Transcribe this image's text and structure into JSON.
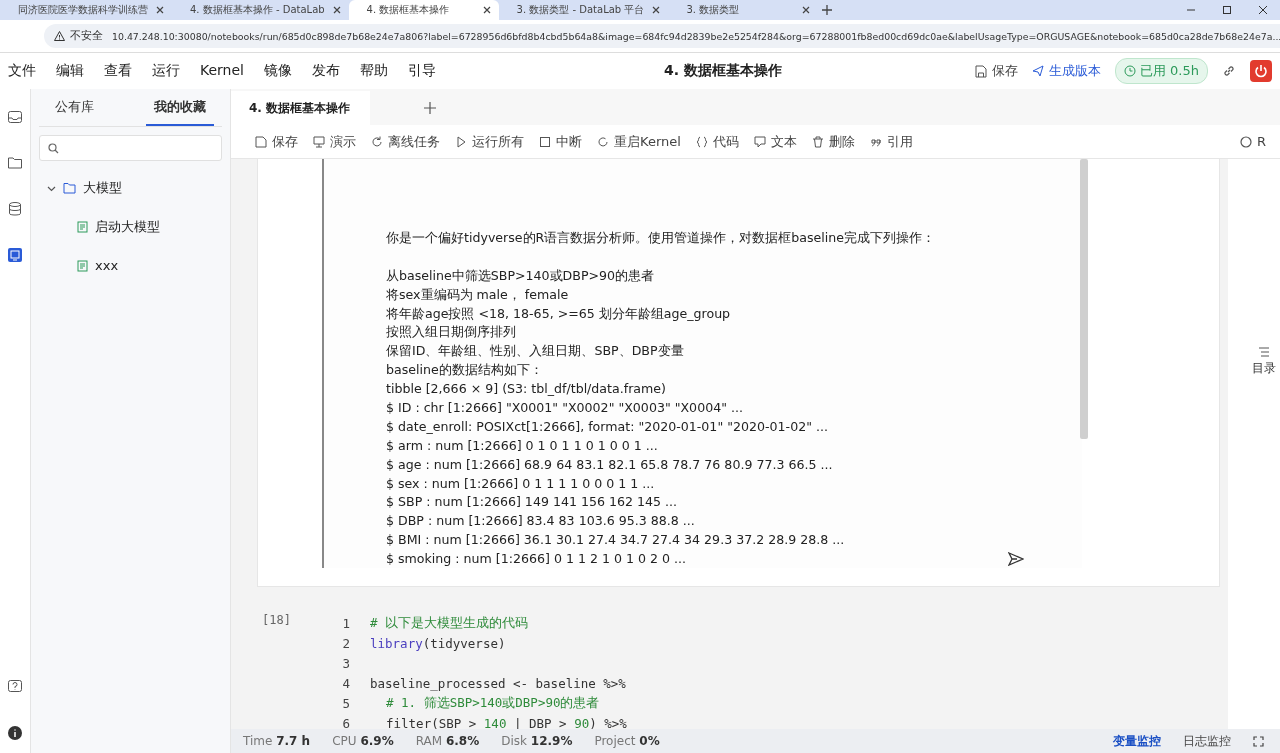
{
  "browser": {
    "tabs": [
      {
        "label": "同济医院医学数据科学训练营",
        "selected": false
      },
      {
        "label": "4. 数据框基本操作 - DataLab",
        "selected": false
      },
      {
        "label": "4. 数据框基本操作",
        "selected": true
      },
      {
        "label": "3. 数据类型 - DataLab 平台",
        "selected": false
      },
      {
        "label": "3. 数据类型",
        "selected": false
      }
    ],
    "security_label": "不安全",
    "url": "10.47.248.10:30080/notebooks/run/685d0c898de7b68e24e7a806?label=6728956d6bfd8b4cbd5b64a8&image=684fc94d2839be2e5254f284&org=67288001fb8ed00cd69dc0ae&labelUsageType=ORGUSAGE&notebook=685d0ca28de7b68e24e7a..."
  },
  "menu": {
    "items": [
      "文件",
      "编辑",
      "查看",
      "运行",
      "Kernel",
      "镜像",
      "发布",
      "帮助",
      "引导"
    ],
    "title": "4. 数据框基本操作",
    "save": "保存",
    "publish": "生成版本",
    "usage": "已用 0.5h"
  },
  "sidebar": {
    "tabs": [
      {
        "label": "公有库",
        "selected": false
      },
      {
        "label": "我的收藏",
        "selected": true
      }
    ],
    "tree": [
      {
        "label": "大模型",
        "expanded": true,
        "children": [
          {
            "label": "启动大模型"
          },
          {
            "label": "xxx"
          }
        ]
      }
    ]
  },
  "notebook_tabs": [
    {
      "label": "4. 数据框基本操作",
      "selected": true
    }
  ],
  "toolbar": [
    "保存",
    "演示",
    "离线任务",
    "运行所有",
    "中断",
    "重启Kernel",
    "代码",
    "文本",
    "删除",
    "引用"
  ],
  "kernel": "R",
  "prompt_intro": "你是一个偏好tidyverse的R语言数据分析师。使用管道操作，对数据框baseline完成下列操作：",
  "prompt_lines": [
    "从baseline中筛选SBP>140或DBP>90的患者",
    "将sex重编码为 male， female",
    "将年龄age按照 <18, 18-65, >=65 划分年龄组age_group",
    "按照入组日期倒序排列",
    "保留ID、年龄组、性别、入组日期、SBP、DBP变量",
    "baseline的数据结构如下：",
    "tibble [2,666 × 9] (S3: tbl_df/tbl/data.frame)",
    "$ ID : chr [1:2666] \"X0001\" \"X0002\" \"X0003\" \"X0004\" ...",
    "$ date_enroll: POSIXct[1:2666], format: \"2020-01-01\" \"2020-01-02\" ...",
    "$ arm : num [1:2666] 0 1 0 1 1 0 1 0 0 1 ...",
    "$ age : num [1:2666] 68.9 64 83.1 82.1 65.8 78.7 76 80.9 77.3 66.5 ...",
    "$ sex : num [1:2666] 0 1 1 1 1 0 0 0 1 1 ...",
    "$ SBP : num [1:2666] 149 141 156 162 145 ...",
    "$ DBP : num [1:2666] 83.4 83 103.6 95.3 88.8 ...",
    "$ BMI : num [1:2666] 36.1 30.1 27.4 34.7 27.4 34 29.3 37.2 28.9 28.8 ...",
    "$ smoking : num [1:2666] 0 1 1 2 1 0 1 0 2 0 ..."
  ],
  "outline_button": "目录",
  "code_cell": {
    "prompt": "[18]",
    "lines": [
      {
        "number": "1",
        "indent": false,
        "segments": [
          {
            "kind": "comment",
            "text": "# 以下是大模型生成的代码"
          }
        ]
      },
      {
        "number": "2",
        "indent": false,
        "segments": [
          {
            "kind": "keyword",
            "text": "library"
          },
          {
            "kind": "plain",
            "text": "(tidyverse)"
          }
        ]
      },
      {
        "number": "3"
      },
      {
        "number": "4",
        "indent": false,
        "segments": [
          {
            "kind": "plain",
            "text": "baseline_processed <- baseline %>%"
          }
        ]
      },
      {
        "number": "5",
        "indent": true,
        "segments": [
          {
            "kind": "comment",
            "text": "# 1. 筛选SBP>140或DBP>90的患者"
          }
        ]
      },
      {
        "number": "6",
        "indent": true,
        "segments": [
          {
            "kind": "plain",
            "text": "filter(SBP > "
          },
          {
            "kind": "number",
            "text": "140"
          },
          {
            "kind": "plain",
            "text": " | DBP > "
          },
          {
            "kind": "number",
            "text": "90"
          },
          {
            "kind": "plain",
            "text": ") %>%"
          }
        ]
      }
    ]
  },
  "status": {
    "metrics": [
      {
        "label": "Time",
        "value": "7.7 h"
      },
      {
        "label": "CPU",
        "value": "6.9%"
      },
      {
        "label": "RAM",
        "value": "6.8%"
      },
      {
        "label": "Disk",
        "value": "12.9%"
      },
      {
        "label": "Project",
        "value": "0%"
      }
    ],
    "monitors": [
      {
        "label": "变量监控",
        "selected": true
      },
      {
        "label": "日志监控",
        "selected": false
      }
    ]
  }
}
